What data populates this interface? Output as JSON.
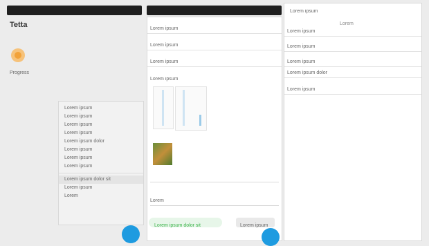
{
  "window": {
    "title_left": "",
    "title_right": ""
  },
  "left": {
    "heading": "Tetta",
    "subheading": "Progress",
    "badge_color": "#f2a23a"
  },
  "context_menu": {
    "items": [
      "Lorem ipsum",
      "Lorem ipsum",
      "Lorem ipsum",
      "Lorem ipsum",
      "Lorem ipsum dolor",
      "Lorem ipsum",
      "Lorem ipsum",
      "Lorem ipsum",
      "Lorem ipsum dolor sit",
      "Lorem ipsum",
      "Lorem"
    ]
  },
  "middle": {
    "fields": [
      "Lorem ipsum",
      "Lorem ipsum",
      "Lorem ipsum"
    ],
    "section_label": "Lorem ipsum",
    "footer_label": "Lorem",
    "success_text": "Lorem ipsum dolor sit",
    "button_label": "Lorem ipsum"
  },
  "right": {
    "header": "Lorem ipsum",
    "tab": "Lorem",
    "rows": [
      "Lorem ipsum",
      "Lorem ipsum",
      "Lorem ipsum",
      "Lorem ipsum dolor",
      "Lorem ipsum"
    ]
  },
  "colors": {
    "accent": "#1e9be0",
    "success": "#3bb34a",
    "dark": "#1f1f1f"
  }
}
